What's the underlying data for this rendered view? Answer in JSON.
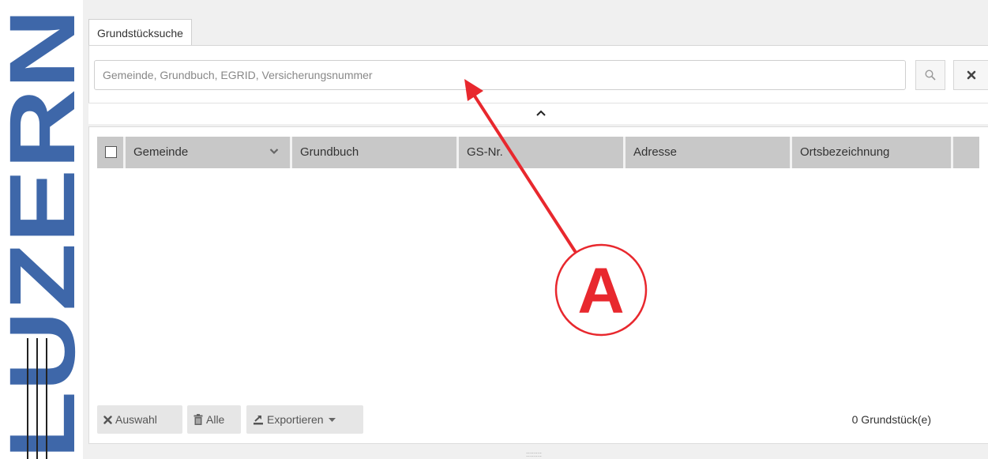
{
  "logo": {
    "text": "LUZERN",
    "color": "#3e67a9"
  },
  "tabs": [
    {
      "label": "Grundstücksuche",
      "active": true
    }
  ],
  "search": {
    "placeholder": "Gemeinde, Grundbuch, EGRID, Versicherungsnummer",
    "value": "",
    "search_icon": "magnifier-icon",
    "clear_icon": "close-x-icon"
  },
  "collapse_icon": "chevron-up-icon",
  "table": {
    "select_all_checked": false,
    "columns": [
      "Gemeinde",
      "Grundbuch",
      "GS-Nr.",
      "Adresse",
      "Ortsbezeichnung",
      ""
    ],
    "sort_icon": "chevron-down-icon",
    "rows": []
  },
  "footer": {
    "auswahl_label": "Auswahl",
    "alle_label": "Alle",
    "export_label": "Exportieren",
    "count_text": "0 Grundstück(e)"
  },
  "resize_handle": "::::::::",
  "annotation": {
    "label": "A",
    "color": "#e8282e"
  }
}
